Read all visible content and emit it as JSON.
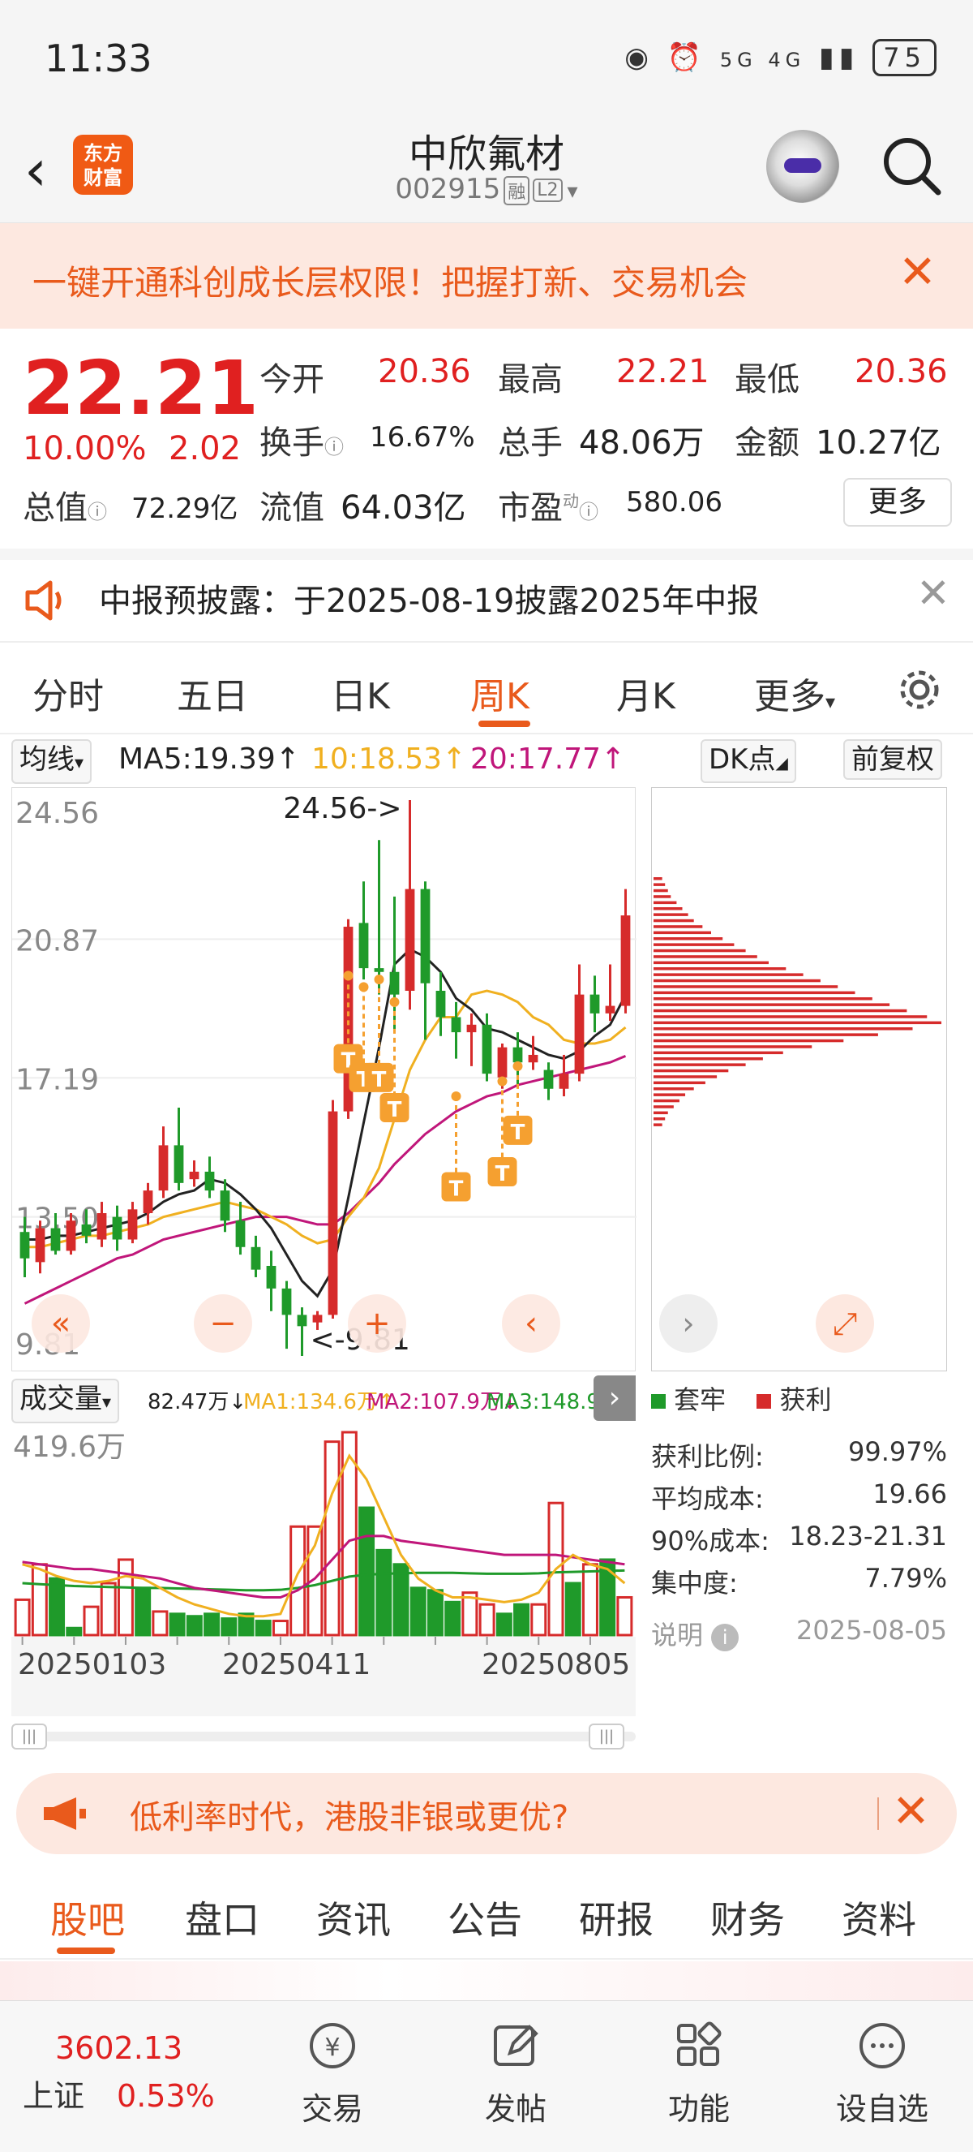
{
  "status": {
    "time": "11:33",
    "signal": "5G 4G",
    "battery": "75"
  },
  "nav": {
    "title": "中欣氟材",
    "code": "002915",
    "tag1": "融",
    "tag2": "L2",
    "logo_line1": "东方",
    "logo_line2": "财富"
  },
  "banner": {
    "text": "一键开通科创成长层权限！把握打新、交易机会"
  },
  "quote": {
    "price": "22.21",
    "change_pct": "10.00%",
    "change_amt": "2.02",
    "open_label": "今开",
    "open": "20.36",
    "high_label": "最高",
    "high": "22.21",
    "low_label": "最低",
    "low": "20.36",
    "turnover_label": "换手",
    "turnover": "16.67%",
    "volume_label": "总手",
    "volume": "48.06万",
    "amount_label": "金额",
    "amount": "10.27亿",
    "mktcap_label": "总值",
    "mktcap": "72.29亿",
    "float_label": "流值",
    "float": "64.03亿",
    "pe_label": "市盈",
    "pe_sup": "动",
    "pe": "580.06",
    "more": "更多"
  },
  "notice": {
    "text": "中报预披露：于2025-08-19披露2025年中报"
  },
  "tabs": [
    "分时",
    "五日",
    "日K",
    "周K",
    "月K",
    "更多"
  ],
  "ma": {
    "type": "均线",
    "ma5": "MA5:19.39↑",
    "ma10": "10:18.53↑",
    "ma20": "20:17.77↑",
    "dk": "DK点",
    "adj": "前复权"
  },
  "chart_data": {
    "type": "candlestick",
    "title": "",
    "ylim": [
      9.81,
      24.56
    ],
    "y_ticks": [
      "24.56",
      "20.87",
      "17.19",
      "13.50",
      "9.81"
    ],
    "max_label": "24.56->",
    "min_label": "<-9.81",
    "x_ticks": [
      "20250103",
      "20250411",
      "20250805"
    ],
    "candles": [
      [
        13.1,
        12.4,
        13.5,
        11.9
      ],
      [
        12.3,
        13.2,
        13.4,
        12.0
      ],
      [
        13.2,
        12.6,
        13.6,
        12.5
      ],
      [
        12.6,
        13.4,
        13.6,
        12.5
      ],
      [
        13.3,
        13.0,
        13.7,
        12.8
      ],
      [
        12.9,
        13.6,
        13.9,
        12.7
      ],
      [
        13.5,
        12.9,
        13.8,
        12.6
      ],
      [
        12.9,
        13.7,
        13.9,
        12.8
      ],
      [
        13.6,
        14.2,
        14.4,
        13.3
      ],
      [
        14.2,
        15.4,
        15.9,
        14.0
      ],
      [
        15.4,
        14.4,
        16.4,
        14.2
      ],
      [
        14.5,
        14.7,
        15.0,
        14.3
      ],
      [
        14.7,
        14.2,
        15.1,
        14.0
      ],
      [
        14.2,
        13.4,
        14.5,
        13.1
      ],
      [
        13.4,
        12.7,
        13.9,
        12.5
      ],
      [
        12.7,
        12.1,
        13.0,
        11.9
      ],
      [
        12.2,
        11.6,
        12.6,
        11.0
      ],
      [
        11.6,
        10.9,
        11.8,
        10.0
      ],
      [
        10.9,
        10.6,
        11.1,
        9.81
      ],
      [
        10.7,
        10.9,
        11.0,
        10.5
      ],
      [
        10.9,
        16.3,
        16.6,
        10.8
      ],
      [
        16.3,
        21.2,
        21.4,
        16.1
      ],
      [
        21.3,
        20.1,
        22.4,
        19.8
      ],
      [
        20.1,
        20.0,
        23.5,
        19.4
      ],
      [
        20.0,
        19.4,
        22.0,
        18.4
      ],
      [
        19.5,
        22.2,
        24.56,
        19.0
      ],
      [
        22.2,
        19.7,
        22.4,
        18.2
      ],
      [
        19.5,
        18.8,
        20.0,
        18.3
      ],
      [
        18.8,
        18.4,
        19.2,
        17.7
      ],
      [
        18.4,
        18.6,
        18.9,
        17.5
      ],
      [
        18.6,
        17.3,
        18.9,
        17.1
      ],
      [
        17.2,
        18.0,
        18.1,
        16.9
      ],
      [
        18.0,
        17.6,
        18.4,
        17.0
      ],
      [
        17.6,
        17.8,
        18.3,
        17.4
      ],
      [
        17.4,
        16.9,
        17.6,
        16.6
      ],
      [
        16.9,
        17.3,
        17.8,
        16.7
      ],
      [
        17.3,
        19.4,
        20.2,
        17.1
      ],
      [
        19.4,
        18.9,
        19.9,
        18.4
      ],
      [
        18.9,
        19.1,
        20.2,
        18.7
      ],
      [
        19.1,
        21.5,
        22.2,
        18.9
      ]
    ],
    "ma5": [
      12.9,
      12.9,
      13.0,
      13.0,
      13.1,
      13.2,
      13.3,
      13.4,
      13.6,
      13.9,
      14.1,
      14.2,
      14.5,
      14.4,
      14.1,
      13.7,
      13.2,
      12.5,
      11.8,
      11.4,
      12.1,
      14.0,
      16.0,
      18.0,
      20.2,
      20.6,
      20.4,
      20.0,
      19.3,
      19.0,
      18.5,
      18.4,
      18.2,
      18.0,
      17.8,
      17.7,
      17.9,
      18.3,
      18.6,
      19.39
    ],
    "ma10": [
      12.7,
      12.7,
      12.8,
      12.9,
      13.0,
      13.0,
      13.1,
      13.2,
      13.3,
      13.5,
      13.6,
      13.7,
      13.8,
      13.9,
      13.8,
      13.7,
      13.5,
      13.3,
      13.0,
      12.8,
      12.9,
      13.5,
      14.0,
      14.8,
      16.1,
      17.4,
      18.2,
      18.8,
      18.8,
      19.4,
      19.5,
      19.4,
      19.2,
      18.8,
      18.6,
      18.2,
      18.1,
      18.1,
      18.2,
      18.53
    ],
    "ma20": [
      11.2,
      11.4,
      11.6,
      11.8,
      12.0,
      12.2,
      12.4,
      12.5,
      12.7,
      12.9,
      13.0,
      13.1,
      13.2,
      13.3,
      13.4,
      13.5,
      13.5,
      13.5,
      13.4,
      13.3,
      13.3,
      13.6,
      14.0,
      14.4,
      14.9,
      15.3,
      15.7,
      16.0,
      16.3,
      16.5,
      16.7,
      16.8,
      17.0,
      17.1,
      17.2,
      17.3,
      17.4,
      17.5,
      17.6,
      17.77
    ],
    "t_markers": [
      [
        21,
        19.9,
        18.0
      ],
      [
        22,
        19.6,
        17.5
      ],
      [
        23,
        19.8,
        17.5
      ],
      [
        24,
        19.2,
        16.7
      ],
      [
        28,
        16.7,
        14.6
      ],
      [
        31,
        17.1,
        15.0
      ],
      [
        32,
        17.5,
        16.1
      ]
    ],
    "volume_title": "成交量",
    "volume_value": "82.47万↓",
    "vol_ma1": "MA1:134.6万↑",
    "vol_ma2": "MA2:107.9万↓",
    "vol_ma3": "MA3:148.9万↑",
    "volume_max_label": "419.6万",
    "volume": [
      75,
      150,
      120,
      15,
      60,
      110,
      160,
      100,
      50,
      45,
      40,
      45,
      35,
      45,
      30,
      30,
      230,
      230,
      410,
      430,
      270,
      180,
      150,
      100,
      95,
      70,
      90,
      65,
      45,
      65,
      65,
      280,
      110,
      150,
      160,
      80
    ],
    "volume_colors": [
      "r",
      "r",
      "g",
      "g",
      "r",
      "r",
      "r",
      "g",
      "r",
      "g",
      "g",
      "g",
      "g",
      "g",
      "g",
      "r",
      "r",
      "r",
      "r",
      "r",
      "g",
      "g",
      "g",
      "g",
      "g",
      "g",
      "r",
      "r",
      "g",
      "g",
      "r",
      "r",
      "g",
      "r",
      "g",
      "r"
    ],
    "vol_ma_yellow": [
      150,
      140,
      125,
      115,
      110,
      115,
      125,
      120,
      100,
      80,
      65,
      55,
      45,
      40,
      40,
      45,
      130,
      190,
      300,
      380,
      330,
      250,
      170,
      120,
      95,
      80,
      80,
      75,
      70,
      75,
      90,
      140,
      170,
      150,
      140,
      110
    ],
    "vol_ma_purple": [
      155,
      150,
      145,
      140,
      140,
      135,
      130,
      125,
      120,
      110,
      100,
      95,
      90,
      85,
      80,
      80,
      95,
      120,
      160,
      200,
      210,
      210,
      200,
      195,
      190,
      185,
      180,
      175,
      170,
      170,
      170,
      170,
      165,
      160,
      155,
      150
    ],
    "vol_ma_green": [
      110,
      108,
      106,
      104,
      103,
      102,
      101,
      100,
      100,
      99,
      98,
      97,
      96,
      95,
      95,
      96,
      100,
      106,
      115,
      124,
      128,
      130,
      131,
      132,
      132,
      132,
      131,
      130,
      130,
      130,
      131,
      133,
      134,
      135,
      136,
      137
    ],
    "profile": [
      3,
      4,
      5,
      6,
      8,
      10,
      12,
      14,
      17,
      20,
      24,
      28,
      32,
      36,
      40,
      46,
      52,
      58,
      64,
      70,
      76,
      82,
      88,
      95,
      100,
      90,
      78,
      66,
      55,
      45,
      38,
      32,
      26,
      22,
      18,
      14,
      11,
      9,
      7,
      5,
      4,
      3
    ]
  },
  "cost": {
    "legend_trap": "套牢",
    "legend_profit": "获利",
    "profit_ratio_label": "获利比例:",
    "profit_ratio": "99.97%",
    "avg_cost_label": "平均成本:",
    "avg_cost": "19.66",
    "cost90_label": "90%成本:",
    "cost90": "18.23-21.31",
    "conc_label": "集中度:",
    "conc": "7.79%",
    "note_label": "说明",
    "date": "2025-08-05"
  },
  "ad": {
    "text": "低利率时代，港股非银或更优?"
  },
  "bottom_tabs": [
    "股吧",
    "盘口",
    "资讯",
    "公告",
    "研报",
    "财务",
    "资料"
  ],
  "footer": {
    "index_value": "3602.13",
    "index_name": "上证",
    "index_pct": "0.53%",
    "trade": "交易",
    "post": "发帖",
    "func": "功能",
    "watch": "设自选"
  },
  "colors": {
    "up": "#d62b2b",
    "down": "#1f9a2a",
    "accent": "#e95a1c",
    "ma5": "#222222",
    "ma10": "#f0b020",
    "ma20": "#c0167a",
    "t_marker": "#f5a030"
  }
}
